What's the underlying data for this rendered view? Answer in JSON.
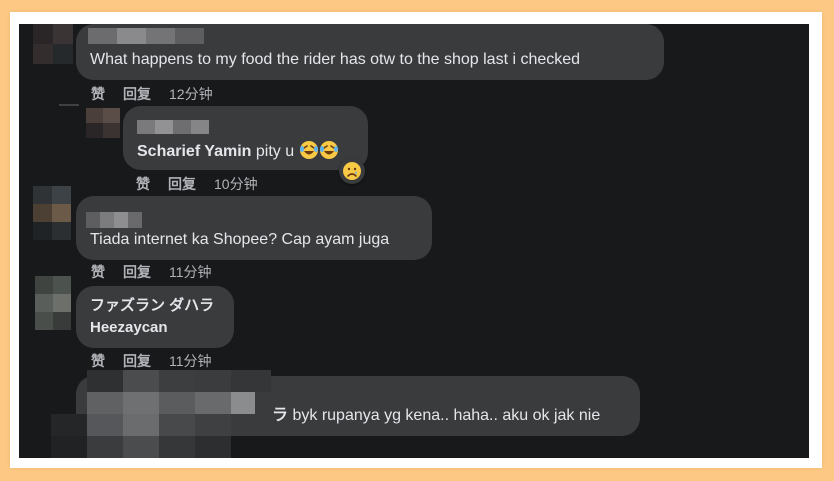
{
  "comments": [
    {
      "text": "What happens to my food the rider has otw to the shop last i checked",
      "like": "赞",
      "reply": "回复",
      "time": "12分钟"
    },
    {
      "name": "Scharief Yamin",
      "text": "pity u",
      "like": "赞",
      "reply": "回复",
      "time": "10分钟",
      "emojis": [
        "laughing-crying-emoji",
        "laughing-crying-emoji"
      ],
      "reaction": "sad-emoji"
    },
    {
      "text": "Tiada internet ka Shopee? Cap ayam juga",
      "like": "赞",
      "reply": "回复",
      "time": "11分钟"
    },
    {
      "name": "ファズラン ダハラ",
      "text": "Heezaycan",
      "like": "赞",
      "reply": "回复",
      "time": "11分钟"
    },
    {
      "name_fragment": "ラ",
      "text": "byk rupanya yg kena.. haha.. aku ok jak nie"
    }
  ],
  "colors": {
    "page_background": "#fdc883",
    "screen_background": "#18191a",
    "bubble": "#3a3b3c",
    "text": "#e4e6eb",
    "meta_text": "#b0b3b8"
  }
}
